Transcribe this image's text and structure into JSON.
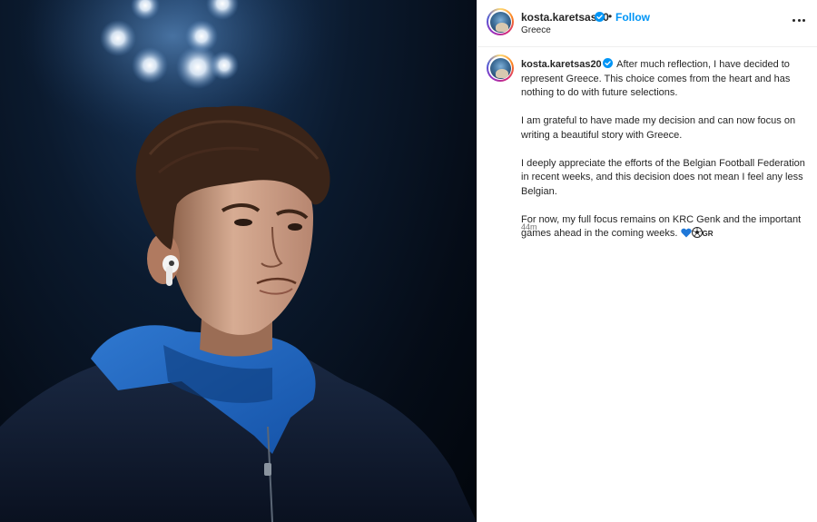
{
  "post": {
    "username": "kosta.karetsas20",
    "verified": true,
    "separator": "•",
    "follow_label": "Follow",
    "location": "Greece",
    "more_icon": "more-horizontal-icon",
    "photo_alt": "Young footballer in a blue hoodie and dark jacket wearing a white earbud under stadium floodlights"
  },
  "caption": {
    "username": "kosta.karetsas20",
    "paragraphs": [
      "After much reflection, I have decided to represent Greece. This choice comes from the heart and has nothing to do with future selections.",
      "I am grateful to have made my decision and can now focus on writing a beautiful story with Greece.",
      "I deeply appreciate the efforts of the Belgian Football Federation in recent weeks, and this decision does not mean I feel any less Belgian.",
      "For now, my full focus remains on KRC Genk and the important games ahead in the coming weeks."
    ],
    "emoji_heart": "blue-heart-icon",
    "emoji_ball": "soccer-ball-icon",
    "flag_text": "GR",
    "timestamp": "44m"
  },
  "colors": {
    "follow": "#0095f6",
    "verified": "#0095f6",
    "text": "#262626",
    "muted": "#737373"
  }
}
